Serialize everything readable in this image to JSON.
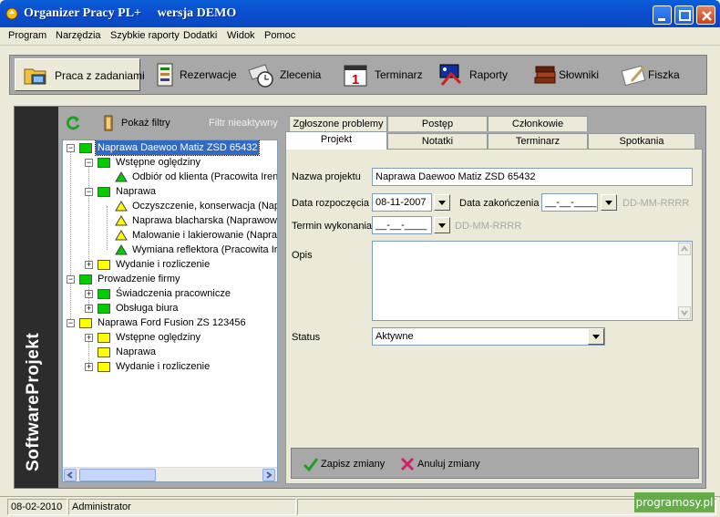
{
  "window": {
    "title": "Organizer Pracy PL+     wersja DEMO"
  },
  "menu": [
    "Program",
    "Narzędzia",
    "Szybkie raporty",
    "Dodatki",
    "Widok",
    "Pomoc"
  ],
  "toolbar": {
    "buttons": [
      {
        "label": "Praca z zadaniami",
        "icon": "folder-computer-icon",
        "active": true
      },
      {
        "label": "Rezerwacje",
        "icon": "reservation-icon"
      },
      {
        "label": "Zlecenia",
        "icon": "orders-clock-icon"
      },
      {
        "label": "Terminarz",
        "icon": "calendar-icon"
      },
      {
        "label": "Raporty",
        "icon": "reports-icon"
      },
      {
        "label": "Słowniki",
        "icon": "books-icon"
      },
      {
        "label": "Fiszka",
        "icon": "note-icon"
      }
    ]
  },
  "sidebar": {
    "brand": "SoftwareProjekt"
  },
  "filters": {
    "show_filters_label": "Pokaż filtry",
    "filter_status": "Filtr nieaktywny"
  },
  "tree": {
    "nodes": [
      {
        "text": "Naprawa Daewoo Matiz ZSD 65432",
        "selected": true
      },
      {
        "text": "Wstępne oględziny"
      },
      {
        "text": "Odbiór od klienta (Pracowita Irena)"
      },
      {
        "text": "Naprawa"
      },
      {
        "text": "Oczyszczenie, konserwacja (Naprawowy)"
      },
      {
        "text": "Naprawa blacharska (Naprawowy)"
      },
      {
        "text": "Malowanie i lakierowanie (Naprawowy)"
      },
      {
        "text": "Wymiana reflektora (Pracowita Irena)"
      },
      {
        "text": "Wydanie i rozliczenie"
      },
      {
        "text": "Prowadzenie firmy"
      },
      {
        "text": "Świadczenia pracownicze"
      },
      {
        "text": "Obsługa biura"
      },
      {
        "text": "Naprawa Ford Fusion ZS 123456"
      },
      {
        "text": "Wstępne oględziny"
      },
      {
        "text": "Naprawa"
      },
      {
        "text": "Wydanie i rozliczenie"
      }
    ]
  },
  "tabs": {
    "row1": [
      "Zgłoszone problemy",
      "Postęp",
      "Członkowie"
    ],
    "row2": [
      "Projekt",
      "Notatki",
      "Terminarz",
      "Spotkania"
    ]
  },
  "form": {
    "name_label": "Nazwa projektu",
    "name_value": "Naprawa Daewoo Matiz ZSD 65432",
    "start_label": "Data rozpoczęcia",
    "start_value": "08-11-2007",
    "end_label": "Data zakończenia",
    "end_value": "__-__-____",
    "date_hint": "DD-MM-RRRR",
    "due_label": "Termin wykonania",
    "due_value": "__-__-____",
    "desc_label": "Opis",
    "status_label": "Status",
    "status_value": "Aktywne"
  },
  "actions": {
    "save": "Zapisz zmiany",
    "cancel": "Anuluj zmiany"
  },
  "statusbar": {
    "date": "08-02-2010",
    "user": "Administrator"
  },
  "watermark": "programosy.pl",
  "colors": {
    "titlebar": "#0a5fd8",
    "folder_green": "#00cc00",
    "folder_yellow": "#ffff00",
    "selection": "#316ac5"
  }
}
